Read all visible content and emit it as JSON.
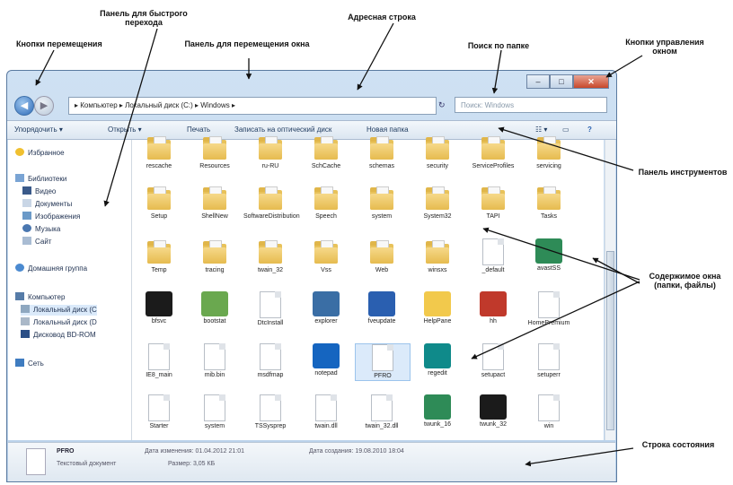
{
  "annotations": {
    "quick_access": "Панель для быстрого перехода",
    "address_bar": "Адресная строка",
    "nav_buttons": "Кнопки перемещения",
    "move_pane": "Панель для перемещения окна",
    "folder_search": "Поиск по папке",
    "window_controls": "Кнопки управления окном",
    "toolbar": "Панель инструментов",
    "window_content": "Содержимое окна (папки, файлы)",
    "status_bar": "Строка состояния"
  },
  "window": {
    "controls": {
      "minimize": "–",
      "maximize": "□",
      "close": "✕"
    }
  },
  "nav": {
    "back": "◀",
    "forward": "▶",
    "address": "▸ Компьютер ▸ Локальный диск (C:) ▸ Windows ▸",
    "refresh": "↻",
    "search_placeholder": "Поиск: Windows"
  },
  "toolbar": {
    "organize": "Упорядочить ▾",
    "open": "Открыть ▾",
    "print": "Печать",
    "burn": "Записать на оптический диск",
    "new_folder": "Новая папка",
    "view": "☷ ▾",
    "preview": "▭",
    "help": "?"
  },
  "sidebar": {
    "favorites": "Избранное",
    "libraries": "Библиотеки",
    "video": "Видео",
    "documents": "Документы",
    "images": "Изображения",
    "music": "Музыка",
    "site": "Сайт",
    "homegroup": "Домашняя группа",
    "computer": "Компьютер",
    "disk_c": "Локальный диск (C",
    "disk_d": "Локальный диск (D",
    "bd_rom": "Дисковод BD-ROM",
    "network": "Сеть"
  },
  "items": [
    {
      "label": "rescache",
      "kind": "folder"
    },
    {
      "label": "Resources",
      "kind": "folder"
    },
    {
      "label": "ru-RU",
      "kind": "folder"
    },
    {
      "label": "SchCache",
      "kind": "folder"
    },
    {
      "label": "schemas",
      "kind": "folder"
    },
    {
      "label": "security",
      "kind": "folder"
    },
    {
      "label": "ServiceProfiles",
      "kind": "folder"
    },
    {
      "label": "servicing",
      "kind": "folder"
    },
    {
      "label": "Setup",
      "kind": "folder"
    },
    {
      "label": "ShellNew",
      "kind": "folder"
    },
    {
      "label": "SoftwareDistribution",
      "kind": "folder"
    },
    {
      "label": "Speech",
      "kind": "folder"
    },
    {
      "label": "system",
      "kind": "folder"
    },
    {
      "label": "System32",
      "kind": "folder"
    },
    {
      "label": "TAPI",
      "kind": "folder"
    },
    {
      "label": "Tasks",
      "kind": "folder"
    },
    {
      "label": "Temp",
      "kind": "folder"
    },
    {
      "label": "tracing",
      "kind": "folder"
    },
    {
      "label": "twain_32",
      "kind": "folder"
    },
    {
      "label": "Vss",
      "kind": "folder"
    },
    {
      "label": "Web",
      "kind": "folder"
    },
    {
      "label": "winsxs",
      "kind": "folder"
    },
    {
      "label": "_default",
      "kind": "doc"
    },
    {
      "label": "avastSS",
      "kind": "app"
    },
    {
      "label": "bfsvc",
      "kind": "app"
    },
    {
      "label": "bootstat",
      "kind": "app"
    },
    {
      "label": "DtcInstall",
      "kind": "doc"
    },
    {
      "label": "explorer",
      "kind": "app"
    },
    {
      "label": "fveupdate",
      "kind": "app"
    },
    {
      "label": "HelpPane",
      "kind": "app"
    },
    {
      "label": "hh",
      "kind": "app"
    },
    {
      "label": "HomePremium",
      "kind": "doc"
    },
    {
      "label": "IE8_main",
      "kind": "doc"
    },
    {
      "label": "mib.bin",
      "kind": "doc"
    },
    {
      "label": "msdfmap",
      "kind": "doc"
    },
    {
      "label": "notepad",
      "kind": "app"
    },
    {
      "label": "PFRO",
      "kind": "doc"
    },
    {
      "label": "regedit",
      "kind": "app"
    },
    {
      "label": "setupact",
      "kind": "doc"
    },
    {
      "label": "setuperr",
      "kind": "doc"
    },
    {
      "label": "Starter",
      "kind": "doc"
    },
    {
      "label": "system",
      "kind": "doc"
    },
    {
      "label": "TSSysprep",
      "kind": "doc"
    },
    {
      "label": "twain.dll",
      "kind": "doc"
    },
    {
      "label": "twain_32.dll",
      "kind": "doc"
    },
    {
      "label": "twunk_16",
      "kind": "app"
    },
    {
      "label": "twunk_32",
      "kind": "app"
    },
    {
      "label": "win",
      "kind": "doc"
    }
  ],
  "status": {
    "name": "PFRO",
    "type": "Текстовый документ",
    "modified_label": "Дата изменения: 01.04.2012 21:01",
    "size_label": "Размер: 3,05 КБ",
    "created_label": "Дата создания: 19.08.2010 18:04"
  },
  "colors": {
    "folder": "#e8c25a",
    "window_frame": "#b9d1ea",
    "close_button": "#c8482b",
    "selection": "#dbeafa"
  }
}
